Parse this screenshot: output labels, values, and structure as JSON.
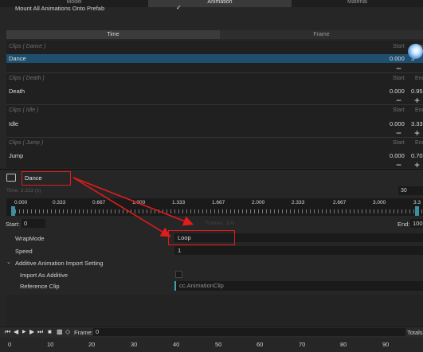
{
  "tabs": [
    {
      "label": "Model"
    },
    {
      "label": "Animation"
    },
    {
      "label": "Material"
    }
  ],
  "mount": {
    "label": "Mount All Animations Onto Prefab",
    "checked": "✓"
  },
  "subtabs": [
    {
      "label": "Time"
    },
    {
      "label": "Frame"
    }
  ],
  "clips": [
    {
      "header": "Clips ( Dance )",
      "name": "Dance",
      "start": "0.000",
      "end": "3",
      "start_label": "Start",
      "end_label": "End"
    },
    {
      "header": "Clips ( Death )",
      "name": "Death",
      "start": "0.000",
      "end": "0.95",
      "start_label": "Start",
      "end_label": "End"
    },
    {
      "header": "Clips ( Idle )",
      "name": "Idle",
      "start": "0.000",
      "end": "3.33",
      "start_label": "Start",
      "end_label": "End"
    },
    {
      "header": "Clips ( Jump )",
      "name": "Jump",
      "start": "0.000",
      "end": "0.70",
      "start_label": "Start",
      "end_label": "End"
    }
  ],
  "preview": {
    "clip_name": "Dance",
    "time_label": "Time: 3.333 (s)",
    "fps": "30"
  },
  "ruler_ticks": [
    "0.000",
    "0.333",
    "0.667",
    "1.000",
    "1.333",
    "1.667",
    "2.000",
    "2.333",
    "2.667",
    "3.000",
    "3.3"
  ],
  "range": {
    "start_label": "Start:",
    "start_value": "0",
    "frames_label": "Frames: 100",
    "end_label": "End:",
    "end_value": "100"
  },
  "props": {
    "wrap_label": "WrapMode",
    "wrap_value": "Loop",
    "speed_label": "Speed",
    "speed_value": "1",
    "additive_label": "Additive Animation Import Setting",
    "import_additive_label": "Import As Additive",
    "ref_label": "Reference Clip",
    "ref_value": "cc.AnimationClip"
  },
  "bottom": {
    "frame_label": "Frame:",
    "frame_value": "0",
    "totals_label": "Totals:",
    "ruler": [
      "0",
      "10",
      "20",
      "30",
      "40",
      "50",
      "60",
      "70",
      "80",
      "90"
    ]
  },
  "colors": {
    "annotation": "#e21b1b",
    "selection": "#1f4f6f",
    "accent": "#3aa3b0"
  }
}
